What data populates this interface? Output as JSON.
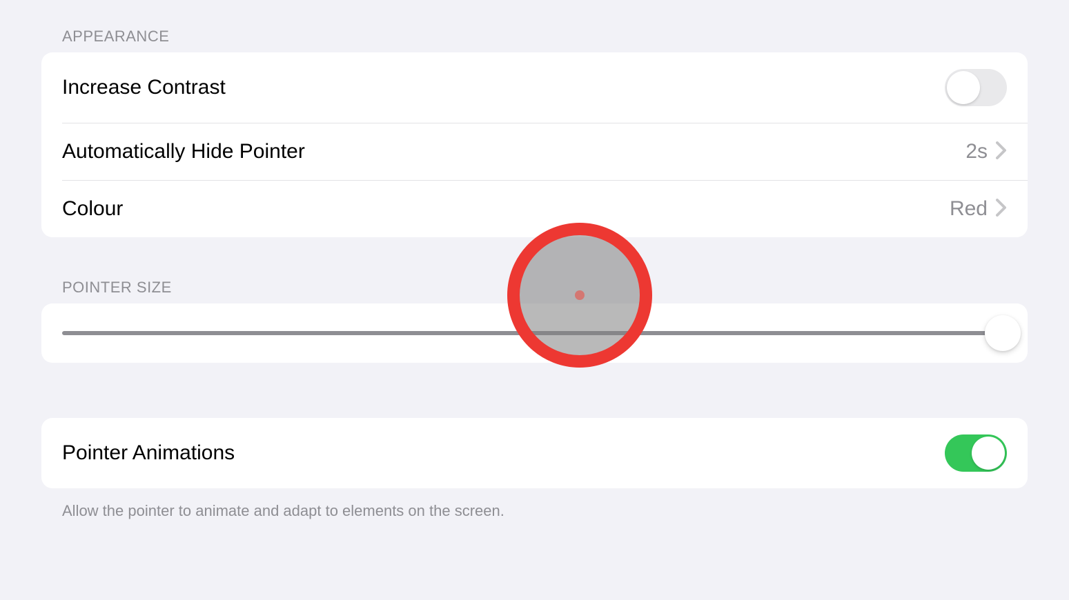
{
  "appearance": {
    "header": "APPEARANCE",
    "increase_contrast_label": "Increase Contrast",
    "increase_contrast_on": false,
    "auto_hide_label": "Automatically Hide Pointer",
    "auto_hide_value": "2s",
    "colour_label": "Colour",
    "colour_value": "Red"
  },
  "pointer_size": {
    "header": "POINTER SIZE",
    "value": 100
  },
  "pointer_animations": {
    "label": "Pointer Animations",
    "on": true,
    "footer": "Allow the pointer to animate and adapt to elements on the screen."
  }
}
